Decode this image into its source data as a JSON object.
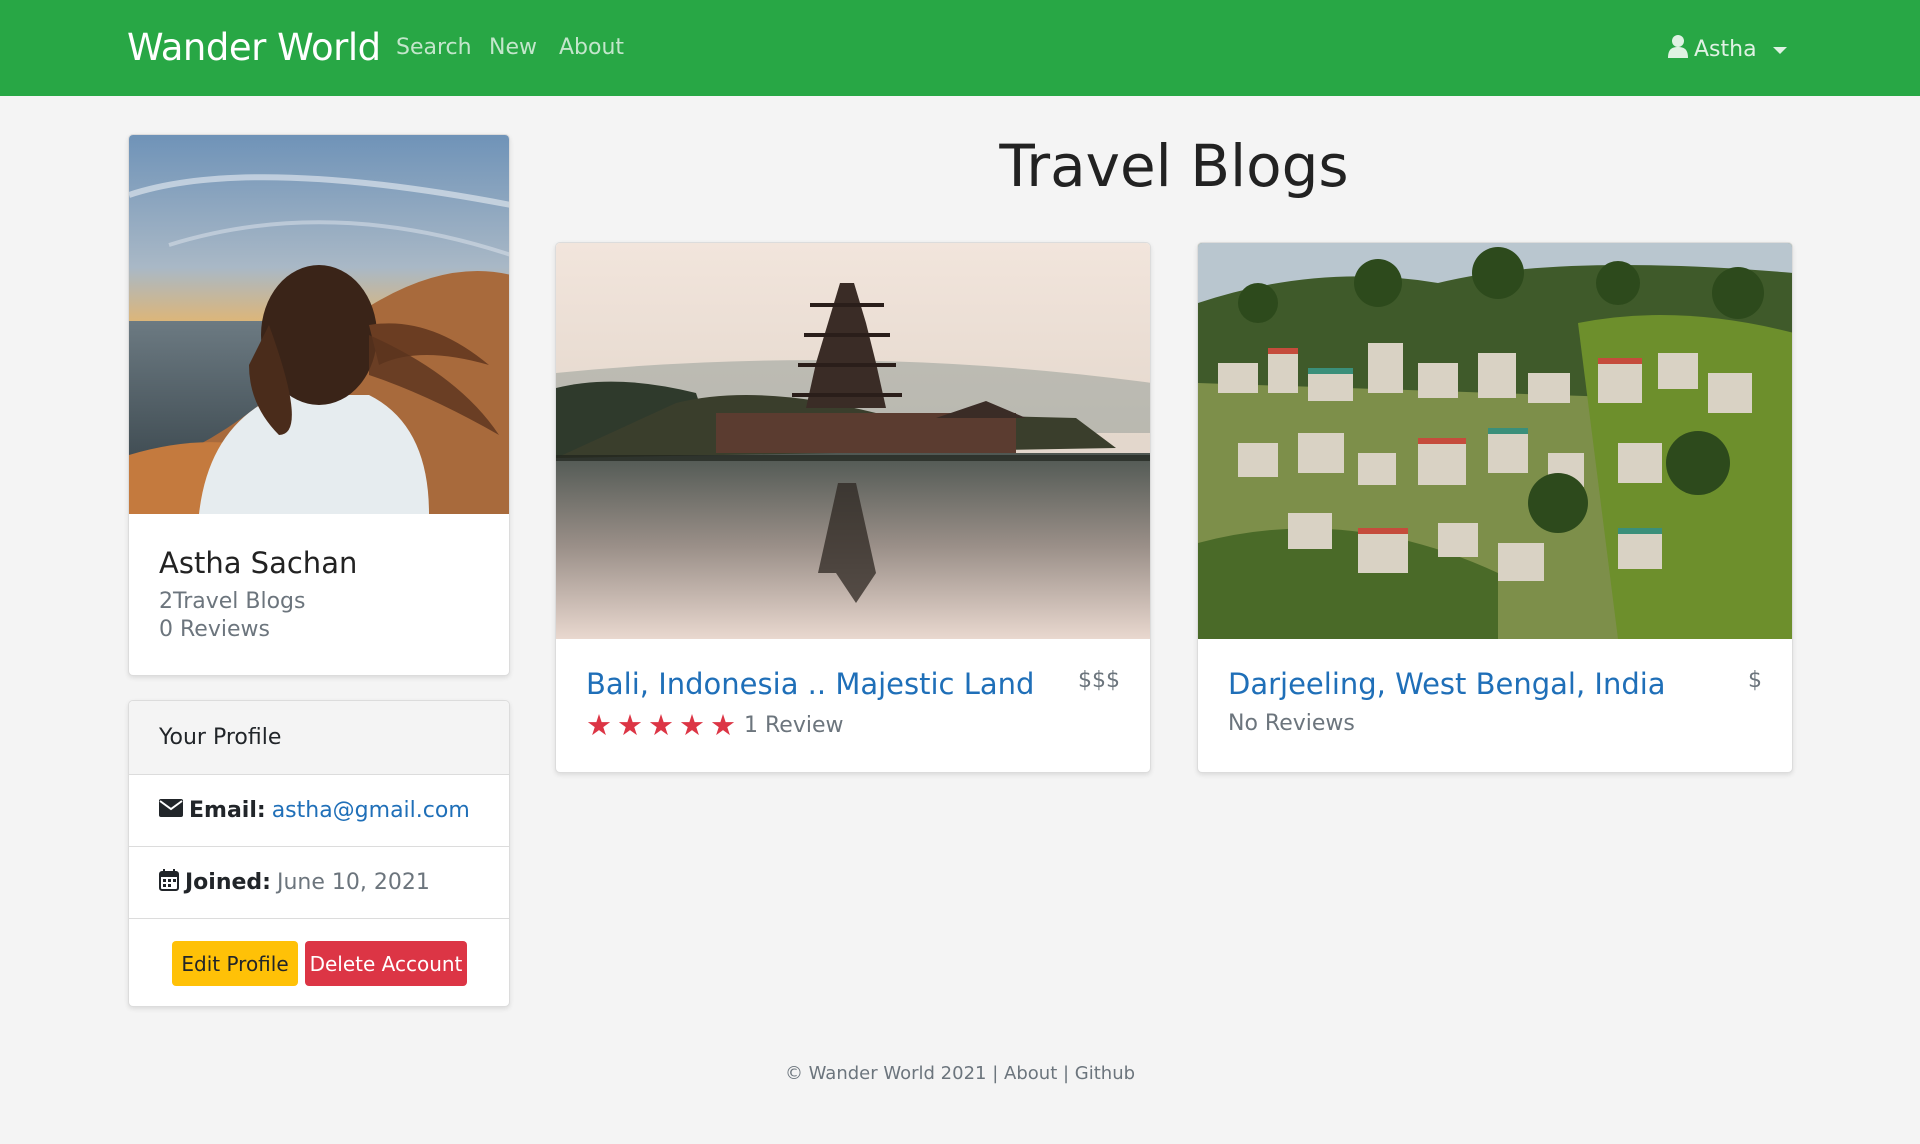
{
  "navbar": {
    "brand": "Wander World",
    "links": [
      "Search",
      "New",
      "About"
    ],
    "user": "Astha",
    "color": "#28a745"
  },
  "profile": {
    "name": "Astha Sachan",
    "blogs": "2Travel Blogs",
    "reviews": "0 Reviews",
    "panel_title": "Your Profile",
    "email_label": "Email:",
    "email": "astha@gmail.com",
    "joined_label": "Joined:",
    "joined": "June 10, 2021",
    "edit_button": "Edit Profile",
    "delete_button": "Delete Account"
  },
  "main": {
    "title": "Travel Blogs",
    "blogs": [
      {
        "title": "Bali, Indonesia .. Majestic Land",
        "price": "$$$",
        "stars": 5,
        "reviews": "1 Review"
      },
      {
        "title": "Darjeeling, West Bengal, India",
        "price": "$",
        "stars": 0,
        "reviews": "No Reviews"
      }
    ]
  },
  "footer": {
    "copyright": "© Wander World 2021",
    "sep": "|",
    "about": "About",
    "github": "Github"
  },
  "colors": {
    "danger": "#dc3545",
    "warning": "#ffc107",
    "link": "#1f6fb8"
  }
}
